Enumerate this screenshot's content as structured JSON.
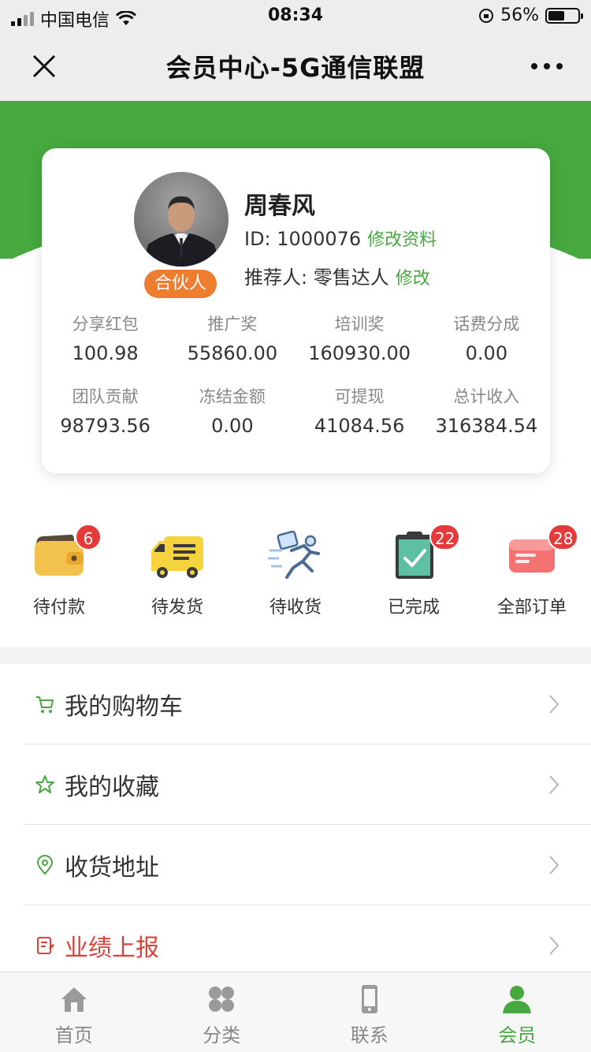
{
  "status_bar": {
    "carrier": "中国电信",
    "time": "08:34",
    "battery": "56%"
  },
  "nav": {
    "title": "会员中心-5G通信联盟"
  },
  "profile": {
    "name": "周春风",
    "id_text": "ID: 1000076",
    "edit_profile": "修改资料",
    "referrer_text": "推荐人: 零售达人",
    "edit_referrer": "修改",
    "badge": "合伙人"
  },
  "stats": [
    {
      "label": "分享红包",
      "value": "100.98"
    },
    {
      "label": "推广奖",
      "value": "55860.00"
    },
    {
      "label": "培训奖",
      "value": "160930.00"
    },
    {
      "label": "话费分成",
      "value": "0.00"
    },
    {
      "label": "团队贡献",
      "value": "98793.56"
    },
    {
      "label": "冻结金额",
      "value": "0.00"
    },
    {
      "label": "可提现",
      "value": "41084.56"
    },
    {
      "label": "总计收入",
      "value": "316384.54"
    }
  ],
  "orders": [
    {
      "label": "待付款",
      "badge": "6",
      "icon": "wallet-icon"
    },
    {
      "label": "待发货",
      "badge": "",
      "icon": "truck-icon"
    },
    {
      "label": "待收货",
      "badge": "",
      "icon": "runner-icon"
    },
    {
      "label": "已完成",
      "badge": "22",
      "icon": "clipboard-check-icon"
    },
    {
      "label": "全部订单",
      "badge": "28",
      "icon": "order-card-icon"
    }
  ],
  "menu": [
    {
      "label": "我的购物车",
      "icon": "cart-icon"
    },
    {
      "label": "我的收藏",
      "icon": "star-icon"
    },
    {
      "label": "收货地址",
      "icon": "location-icon"
    },
    {
      "label": "业绩上报",
      "icon": "report-icon"
    }
  ],
  "tabs": [
    {
      "label": "首页",
      "icon": "home-icon"
    },
    {
      "label": "分类",
      "icon": "category-icon"
    },
    {
      "label": "联系",
      "icon": "phone-icon"
    },
    {
      "label": "会员",
      "icon": "member-icon"
    }
  ],
  "colors": {
    "brand_green": "#46a83f",
    "badge_orange": "#ef7d2f",
    "badge_red": "#e53a3a",
    "report_red": "#d9433a"
  }
}
